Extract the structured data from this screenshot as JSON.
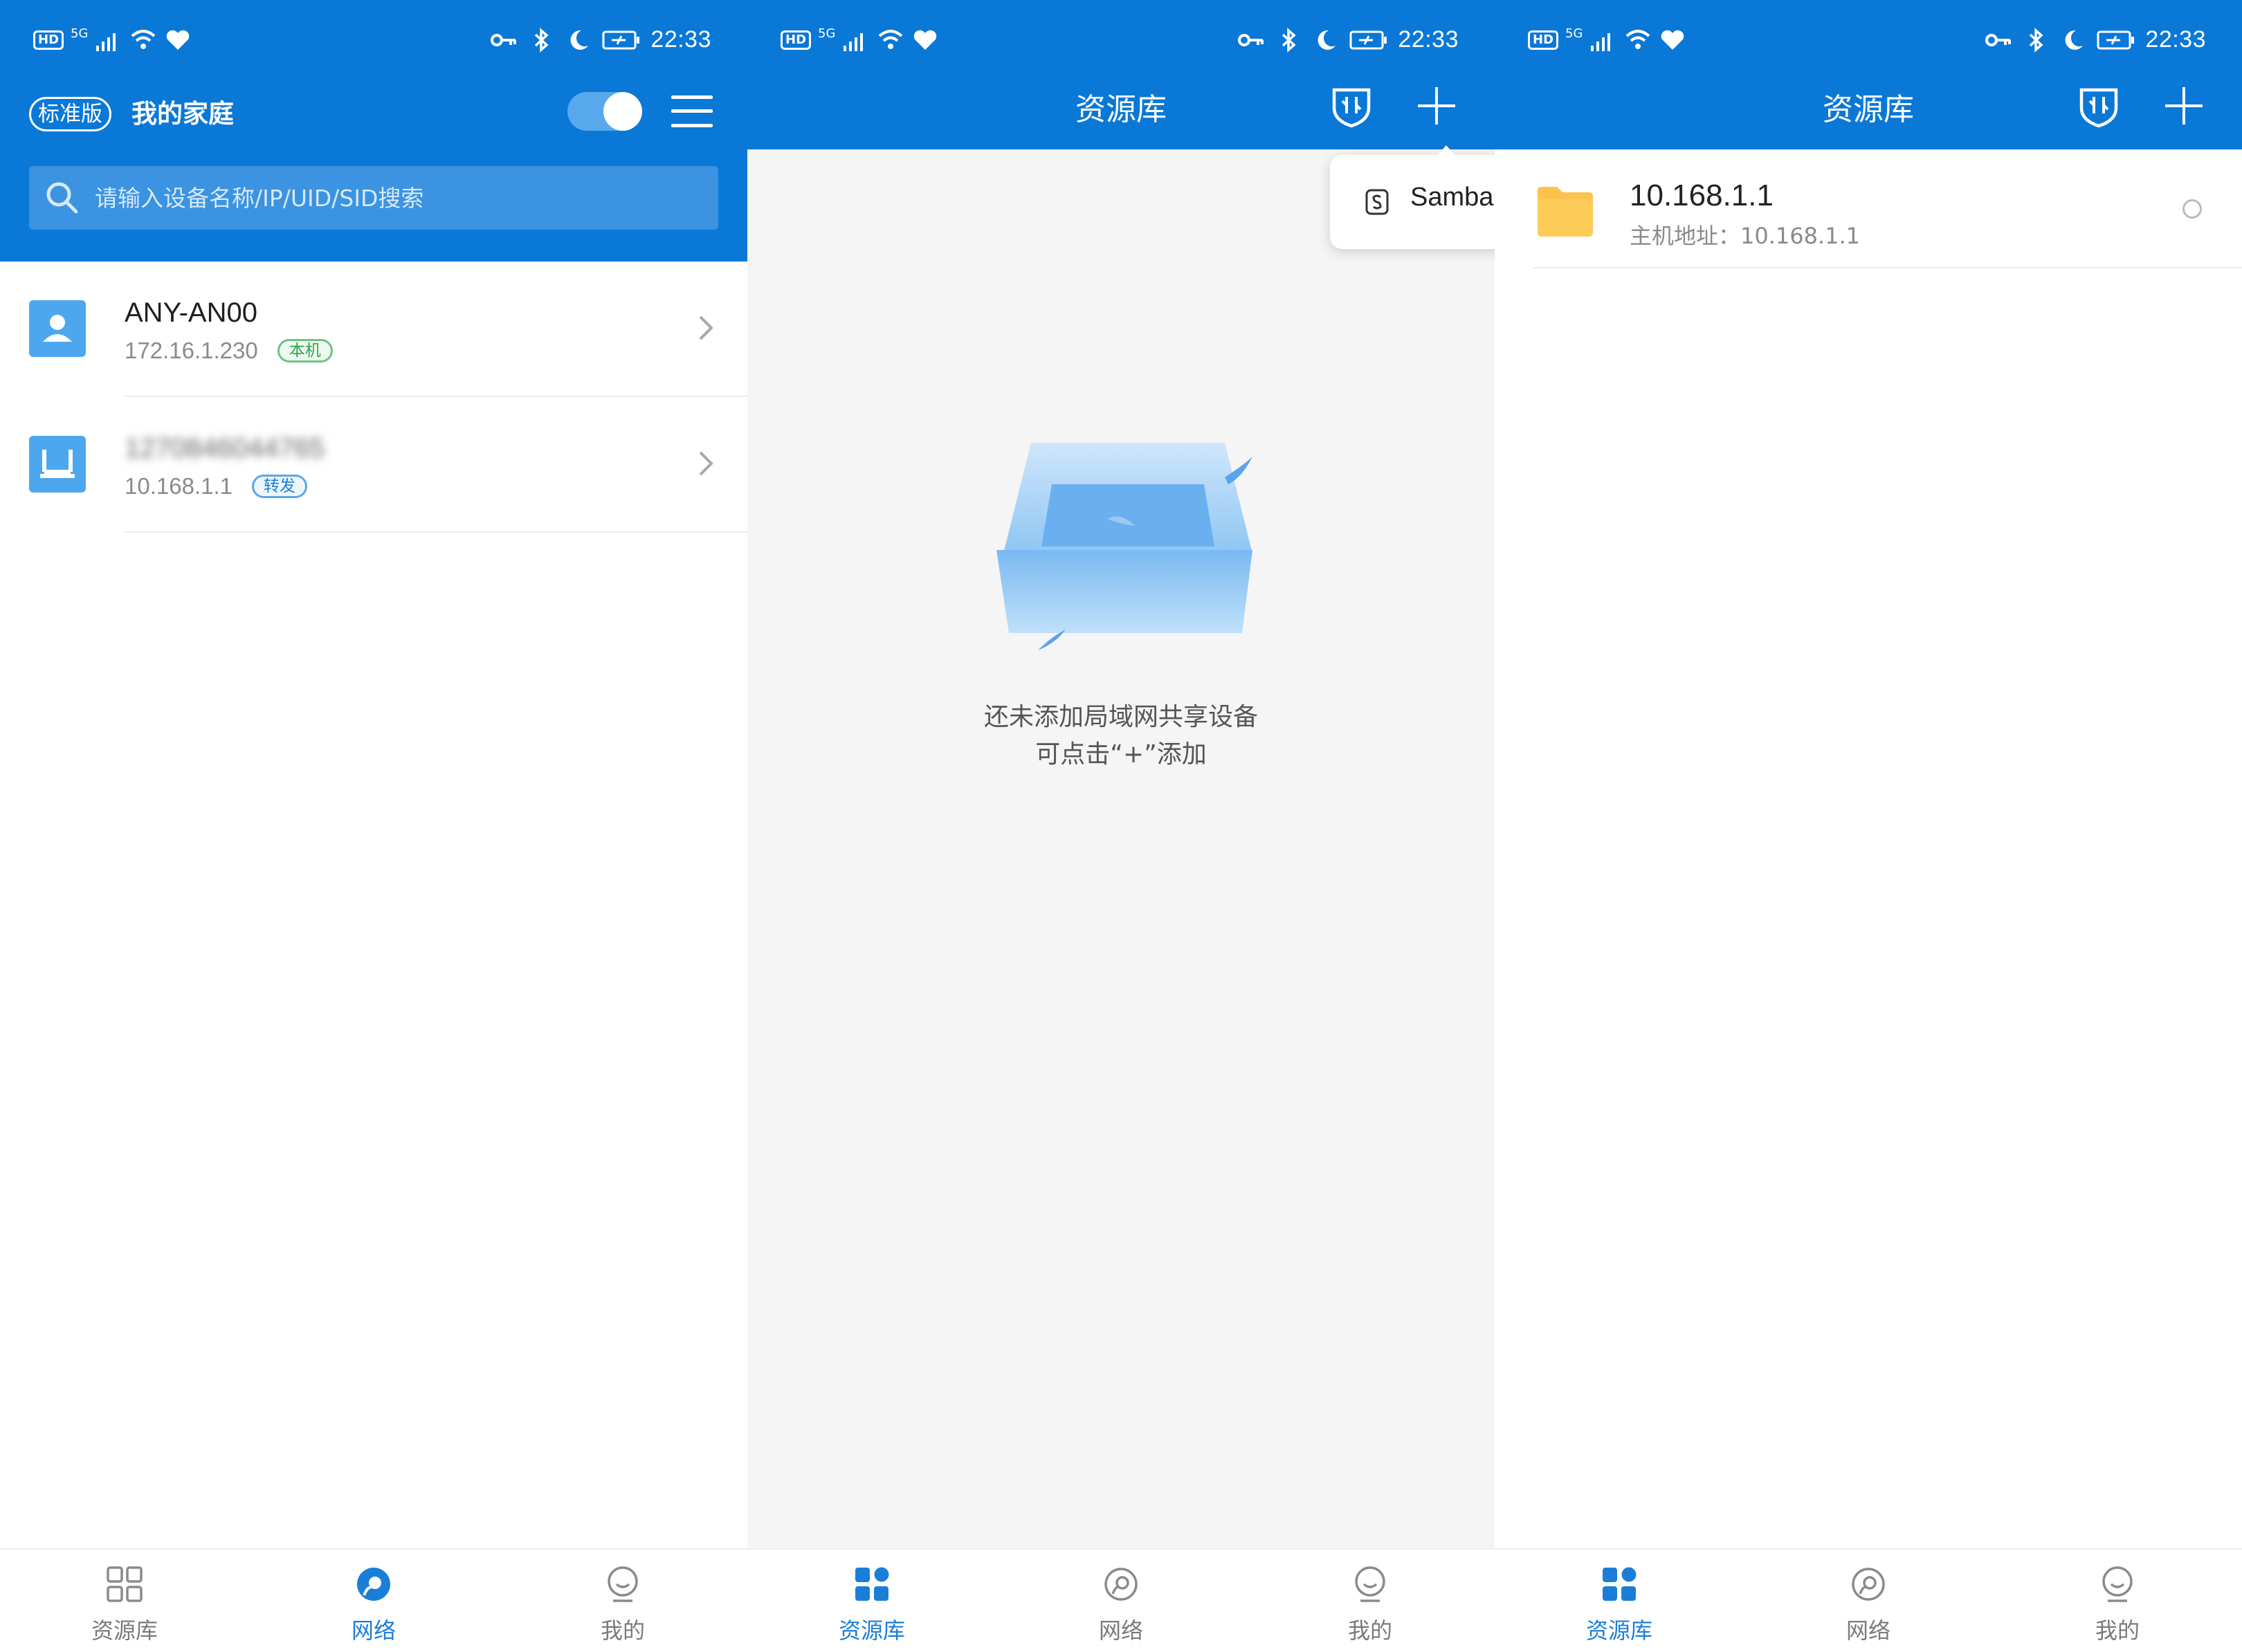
{
  "status_bar": {
    "hd": "HD",
    "network": "5G",
    "time": "22:33"
  },
  "screen1": {
    "edition_badge": "标准版",
    "home_title": "我的家庭",
    "toggle_on": true,
    "search": {
      "placeholder": "请输入设备名称/IP/UID/SID搜索"
    },
    "devices": [
      {
        "name": "ANY-AN00",
        "ip": "172.16.1.230",
        "tag": "本机",
        "icon": "user-device-icon"
      },
      {
        "name": "1270846044765",
        "ip": "10.168.1.1",
        "tag": "转发",
        "icon": "router-icon",
        "blurred": true
      }
    ]
  },
  "screen2": {
    "title": "资源库",
    "popup_item": "Samba",
    "empty_line1": "还未添加局域网共享设备",
    "empty_line2": "可点击“+”添加"
  },
  "screen3": {
    "title": "资源库",
    "resource": {
      "name": "10.168.1.1",
      "host_label": "主机地址：10.168.1.1"
    }
  },
  "bottom_nav": {
    "library": "资源库",
    "network": "网络",
    "mine": "我的"
  },
  "colors": {
    "primary": "#0a78d7",
    "accent_blue": "#1a7ed8",
    "tag_green": "#2fa44c",
    "folder": "#fbc24d"
  }
}
